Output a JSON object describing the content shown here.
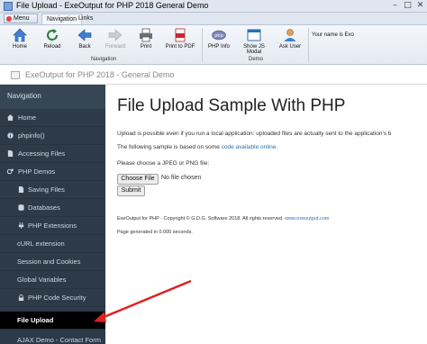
{
  "window": {
    "title": "File Upload - ExeOutput for PHP 2018 General Demo"
  },
  "ribbon": {
    "menu_label": "Menu",
    "tabs": [
      "Navigation",
      "Links"
    ],
    "buttons": {
      "home": "Home",
      "reload": "Reload",
      "back": "Back",
      "forward": "Forward",
      "print": "Print",
      "print_pdf": "Print to PDF",
      "php_info": "PHP Info",
      "show_modal": "Show JS Modal",
      "ask_user": "Ask User"
    },
    "groups": {
      "navigation": "Navigation",
      "demo": "Demo"
    },
    "user_text": "Your name is Exo"
  },
  "addressbar": {
    "title": "ExeOutput for PHP 2018 - General Demo"
  },
  "sidebar": {
    "header": "Navigation",
    "items": [
      {
        "label": "Home",
        "icon": "home-icon"
      },
      {
        "label": "phpinfo()",
        "icon": "info-icon"
      },
      {
        "label": "Accessing Files",
        "icon": "file-icon"
      },
      {
        "label": "PHP Demos",
        "icon": "gears-icon"
      },
      {
        "label": "Saving Files",
        "icon": "file-icon"
      },
      {
        "label": "Databases",
        "icon": "database-icon"
      },
      {
        "label": "PHP Extensions",
        "icon": "plug-icon"
      },
      {
        "label": "cURL extension",
        "icon": ""
      },
      {
        "label": "Session and Cookies",
        "icon": ""
      },
      {
        "label": "Global Variables",
        "icon": ""
      },
      {
        "label": "PHP Code Security",
        "icon": "lock-icon"
      },
      {
        "label": "File Upload",
        "icon": ""
      },
      {
        "label": "AJAX Demo - Contact Form",
        "icon": ""
      }
    ]
  },
  "main": {
    "title": "File Upload Sample With PHP",
    "intro": "Upload is possible even if you run a local application: uploaded files are actually sent to the application's b",
    "sample_prefix": "The following sample is based on some ",
    "sample_link": "code available online",
    "sample_suffix": ".",
    "choose_prompt": "Please choose a JPEG or PNG file:",
    "choose_button": "Choose File",
    "no_file": "No file chosen",
    "submit": "Submit",
    "footer_copyright": "ExeOutput for PHP - Copyright © G.D.G. Software 2018. All rights reserved. ",
    "footer_link": "www.exeoutput.com",
    "generated": "Page generated in 0.005 seconds."
  },
  "colors": {
    "sidebar_bg": "#2d3b48",
    "active_item_bg": "#000000",
    "link": "#2a6fb0",
    "arrow": "#e02020"
  }
}
